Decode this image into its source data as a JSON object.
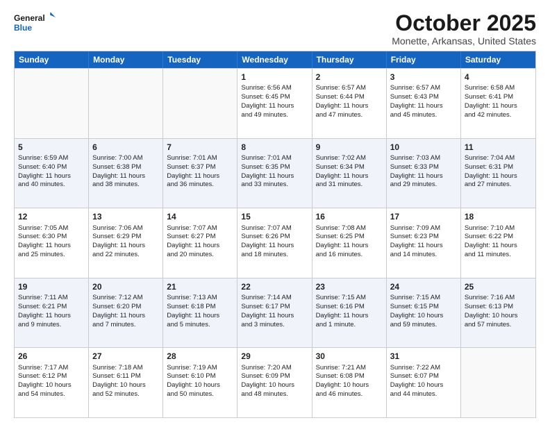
{
  "logo": {
    "line1": "General",
    "line2": "Blue"
  },
  "title": "October 2025",
  "location": "Monette, Arkansas, United States",
  "days_of_week": [
    "Sunday",
    "Monday",
    "Tuesday",
    "Wednesday",
    "Thursday",
    "Friday",
    "Saturday"
  ],
  "weeks": [
    [
      {
        "day": "",
        "text": ""
      },
      {
        "day": "",
        "text": ""
      },
      {
        "day": "",
        "text": ""
      },
      {
        "day": "1",
        "text": "Sunrise: 6:56 AM\nSunset: 6:45 PM\nDaylight: 11 hours\nand 49 minutes."
      },
      {
        "day": "2",
        "text": "Sunrise: 6:57 AM\nSunset: 6:44 PM\nDaylight: 11 hours\nand 47 minutes."
      },
      {
        "day": "3",
        "text": "Sunrise: 6:57 AM\nSunset: 6:43 PM\nDaylight: 11 hours\nand 45 minutes."
      },
      {
        "day": "4",
        "text": "Sunrise: 6:58 AM\nSunset: 6:41 PM\nDaylight: 11 hours\nand 42 minutes."
      }
    ],
    [
      {
        "day": "5",
        "text": "Sunrise: 6:59 AM\nSunset: 6:40 PM\nDaylight: 11 hours\nand 40 minutes."
      },
      {
        "day": "6",
        "text": "Sunrise: 7:00 AM\nSunset: 6:38 PM\nDaylight: 11 hours\nand 38 minutes."
      },
      {
        "day": "7",
        "text": "Sunrise: 7:01 AM\nSunset: 6:37 PM\nDaylight: 11 hours\nand 36 minutes."
      },
      {
        "day": "8",
        "text": "Sunrise: 7:01 AM\nSunset: 6:35 PM\nDaylight: 11 hours\nand 33 minutes."
      },
      {
        "day": "9",
        "text": "Sunrise: 7:02 AM\nSunset: 6:34 PM\nDaylight: 11 hours\nand 31 minutes."
      },
      {
        "day": "10",
        "text": "Sunrise: 7:03 AM\nSunset: 6:33 PM\nDaylight: 11 hours\nand 29 minutes."
      },
      {
        "day": "11",
        "text": "Sunrise: 7:04 AM\nSunset: 6:31 PM\nDaylight: 11 hours\nand 27 minutes."
      }
    ],
    [
      {
        "day": "12",
        "text": "Sunrise: 7:05 AM\nSunset: 6:30 PM\nDaylight: 11 hours\nand 25 minutes."
      },
      {
        "day": "13",
        "text": "Sunrise: 7:06 AM\nSunset: 6:29 PM\nDaylight: 11 hours\nand 22 minutes."
      },
      {
        "day": "14",
        "text": "Sunrise: 7:07 AM\nSunset: 6:27 PM\nDaylight: 11 hours\nand 20 minutes."
      },
      {
        "day": "15",
        "text": "Sunrise: 7:07 AM\nSunset: 6:26 PM\nDaylight: 11 hours\nand 18 minutes."
      },
      {
        "day": "16",
        "text": "Sunrise: 7:08 AM\nSunset: 6:25 PM\nDaylight: 11 hours\nand 16 minutes."
      },
      {
        "day": "17",
        "text": "Sunrise: 7:09 AM\nSunset: 6:23 PM\nDaylight: 11 hours\nand 14 minutes."
      },
      {
        "day": "18",
        "text": "Sunrise: 7:10 AM\nSunset: 6:22 PM\nDaylight: 11 hours\nand 11 minutes."
      }
    ],
    [
      {
        "day": "19",
        "text": "Sunrise: 7:11 AM\nSunset: 6:21 PM\nDaylight: 11 hours\nand 9 minutes."
      },
      {
        "day": "20",
        "text": "Sunrise: 7:12 AM\nSunset: 6:20 PM\nDaylight: 11 hours\nand 7 minutes."
      },
      {
        "day": "21",
        "text": "Sunrise: 7:13 AM\nSunset: 6:18 PM\nDaylight: 11 hours\nand 5 minutes."
      },
      {
        "day": "22",
        "text": "Sunrise: 7:14 AM\nSunset: 6:17 PM\nDaylight: 11 hours\nand 3 minutes."
      },
      {
        "day": "23",
        "text": "Sunrise: 7:15 AM\nSunset: 6:16 PM\nDaylight: 11 hours\nand 1 minute."
      },
      {
        "day": "24",
        "text": "Sunrise: 7:15 AM\nSunset: 6:15 PM\nDaylight: 10 hours\nand 59 minutes."
      },
      {
        "day": "25",
        "text": "Sunrise: 7:16 AM\nSunset: 6:13 PM\nDaylight: 10 hours\nand 57 minutes."
      }
    ],
    [
      {
        "day": "26",
        "text": "Sunrise: 7:17 AM\nSunset: 6:12 PM\nDaylight: 10 hours\nand 54 minutes."
      },
      {
        "day": "27",
        "text": "Sunrise: 7:18 AM\nSunset: 6:11 PM\nDaylight: 10 hours\nand 52 minutes."
      },
      {
        "day": "28",
        "text": "Sunrise: 7:19 AM\nSunset: 6:10 PM\nDaylight: 10 hours\nand 50 minutes."
      },
      {
        "day": "29",
        "text": "Sunrise: 7:20 AM\nSunset: 6:09 PM\nDaylight: 10 hours\nand 48 minutes."
      },
      {
        "day": "30",
        "text": "Sunrise: 7:21 AM\nSunset: 6:08 PM\nDaylight: 10 hours\nand 46 minutes."
      },
      {
        "day": "31",
        "text": "Sunrise: 7:22 AM\nSunset: 6:07 PM\nDaylight: 10 hours\nand 44 minutes."
      },
      {
        "day": "",
        "text": ""
      }
    ]
  ]
}
